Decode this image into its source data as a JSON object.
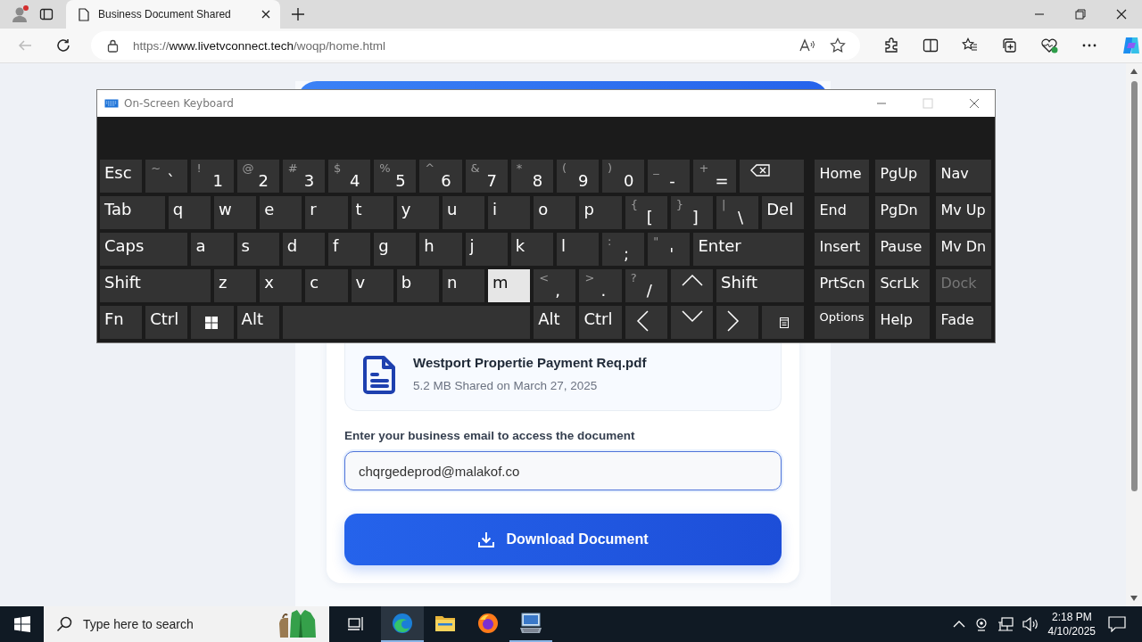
{
  "browser": {
    "tabs": [
      {
        "title": "Business Document Shared",
        "selected": true
      }
    ],
    "url": {
      "scheme": "https://",
      "host": "www.livetvconnect.tech",
      "path": "/woqp/home.html"
    }
  },
  "page": {
    "file": {
      "name": "Westport Propertie Payment Req.pdf",
      "meta": "5.2 MB Shared on March 27, 2025"
    },
    "email_label": "Enter your business email to access the document",
    "email_field": {
      "value": "chqrgedeprod@malakof.co",
      "focused": true
    },
    "download_button": "Download Document"
  },
  "keyboard": {
    "title": "On-Screen Keyboard",
    "main_rows": [
      [
        {
          "kind": "text",
          "label": "Esc",
          "hover": false
        },
        {
          "kind": "dual",
          "shift": "~",
          "label": "`",
          "hover": false
        },
        {
          "kind": "dual",
          "shift": "!",
          "label": "1",
          "hover": false
        },
        {
          "kind": "dual",
          "shift": "@",
          "label": "2",
          "hover": false
        },
        {
          "kind": "dual",
          "shift": "#",
          "label": "3",
          "hover": false
        },
        {
          "kind": "dual",
          "shift": "$",
          "label": "4",
          "hover": false
        },
        {
          "kind": "dual",
          "shift": "%",
          "label": "5",
          "hover": false
        },
        {
          "kind": "dual",
          "shift": "^",
          "label": "6",
          "hover": false
        },
        {
          "kind": "dual",
          "shift": "&",
          "label": "7",
          "hover": false
        },
        {
          "kind": "dual",
          "shift": "*",
          "label": "8",
          "hover": false
        },
        {
          "kind": "dual",
          "shift": "(",
          "label": "9",
          "hover": false
        },
        {
          "kind": "dual",
          "shift": ")",
          "label": "0",
          "hover": false
        },
        {
          "kind": "dual",
          "shift": "_",
          "label": "-",
          "hover": false
        },
        {
          "kind": "dual",
          "shift": "+",
          "label": "=",
          "hover": false
        },
        {
          "kind": "backspace",
          "hover": false
        }
      ],
      [
        {
          "kind": "text",
          "label": "Tab",
          "hover": false
        },
        {
          "kind": "text",
          "label": "q",
          "hover": false
        },
        {
          "kind": "text",
          "label": "w",
          "hover": false
        },
        {
          "kind": "text",
          "label": "e",
          "hover": false
        },
        {
          "kind": "text",
          "label": "r",
          "hover": false
        },
        {
          "kind": "text",
          "label": "t",
          "hover": false
        },
        {
          "kind": "text",
          "label": "y",
          "hover": false
        },
        {
          "kind": "text",
          "label": "u",
          "hover": false
        },
        {
          "kind": "text",
          "label": "i",
          "hover": false
        },
        {
          "kind": "text",
          "label": "o",
          "hover": false
        },
        {
          "kind": "text",
          "label": "p",
          "hover": false
        },
        {
          "kind": "dual",
          "shift": "{",
          "label": "[",
          "hover": false
        },
        {
          "kind": "dual",
          "shift": "}",
          "label": "]",
          "hover": false
        },
        {
          "kind": "dual",
          "shift": "|",
          "label": "\\",
          "hover": false
        },
        {
          "kind": "text",
          "label": "Del",
          "hover": false
        }
      ],
      [
        {
          "kind": "text",
          "label": "Caps",
          "hover": false
        },
        {
          "kind": "text",
          "label": "a",
          "hover": false
        },
        {
          "kind": "text",
          "label": "s",
          "hover": false
        },
        {
          "kind": "text",
          "label": "d",
          "hover": false
        },
        {
          "kind": "text",
          "label": "f",
          "hover": false
        },
        {
          "kind": "text",
          "label": "g",
          "hover": false
        },
        {
          "kind": "text",
          "label": "h",
          "hover": false
        },
        {
          "kind": "text",
          "label": "j",
          "hover": false
        },
        {
          "kind": "text",
          "label": "k",
          "hover": false
        },
        {
          "kind": "text",
          "label": "l",
          "hover": false
        },
        {
          "kind": "dual",
          "shift": ":",
          "label": ";",
          "hover": false
        },
        {
          "kind": "dual",
          "shift": "\"",
          "label": "'",
          "hover": false
        },
        {
          "kind": "text",
          "label": "Enter",
          "hover": false
        }
      ],
      [
        {
          "kind": "text",
          "label": "Shift",
          "hover": false
        },
        {
          "kind": "text",
          "label": "z",
          "hover": false
        },
        {
          "kind": "text",
          "label": "x",
          "hover": false
        },
        {
          "kind": "text",
          "label": "c",
          "hover": false
        },
        {
          "kind": "text",
          "label": "v",
          "hover": false
        },
        {
          "kind": "text",
          "label": "b",
          "hover": false
        },
        {
          "kind": "text",
          "label": "n",
          "hover": false
        },
        {
          "kind": "text",
          "label": "m",
          "hover": true
        },
        {
          "kind": "dual",
          "shift": "<",
          "label": ",",
          "hover": false
        },
        {
          "kind": "dual",
          "shift": ">",
          "label": ".",
          "hover": false
        },
        {
          "kind": "dual",
          "shift": "?",
          "label": "/",
          "hover": false
        },
        {
          "kind": "up",
          "hover": false
        },
        {
          "kind": "text",
          "label": "Shift",
          "hover": false
        }
      ],
      [
        {
          "kind": "text",
          "label": "Fn",
          "hover": false
        },
        {
          "kind": "text",
          "label": "Ctrl",
          "hover": false
        },
        {
          "kind": "windows",
          "hover": false
        },
        {
          "kind": "text",
          "label": "Alt",
          "hover": false
        },
        {
          "kind": "space",
          "hover": false
        },
        {
          "kind": "text",
          "label": "Alt",
          "hover": false
        },
        {
          "kind": "text",
          "label": "Ctrl",
          "hover": false
        },
        {
          "kind": "left",
          "hover": false
        },
        {
          "kind": "down",
          "hover": false
        },
        {
          "kind": "right",
          "hover": false
        },
        {
          "kind": "menu",
          "hover": false
        }
      ]
    ],
    "nav_keys": [
      {
        "label": "Home",
        "hover": false,
        "disabled": false
      },
      {
        "label": "PgUp",
        "hover": false,
        "disabled": false
      },
      {
        "label": "Nav",
        "hover": false,
        "disabled": false
      },
      {
        "label": "End",
        "hover": false,
        "disabled": false
      },
      {
        "label": "PgDn",
        "hover": false,
        "disabled": false
      },
      {
        "label": "Mv Up",
        "hover": false,
        "disabled": false
      },
      {
        "label": "Insert",
        "hover": false,
        "disabled": false
      },
      {
        "label": "Pause",
        "hover": false,
        "disabled": false
      },
      {
        "label": "Mv Dn",
        "hover": false,
        "disabled": false
      },
      {
        "label": "PrtScn",
        "hover": false,
        "disabled": false
      },
      {
        "label": "ScrLk",
        "hover": false,
        "disabled": false
      },
      {
        "label": "Dock",
        "hover": false,
        "disabled": true
      },
      {
        "label": "Options",
        "hover": false,
        "disabled": false
      },
      {
        "label": "Help",
        "hover": false,
        "disabled": false
      },
      {
        "label": "Fade",
        "hover": false,
        "disabled": false
      }
    ]
  },
  "taskbar": {
    "search_placeholder": "Type here to search",
    "apps": [
      {
        "kind": "edge",
        "active": true,
        "running": true
      },
      {
        "kind": "explorer",
        "active": false,
        "running": false
      },
      {
        "kind": "firefox",
        "active": false,
        "running": false
      },
      {
        "kind": "keyboard",
        "active": false,
        "running": true
      }
    ],
    "time": "2:18 PM",
    "date": "4/10/2025"
  }
}
